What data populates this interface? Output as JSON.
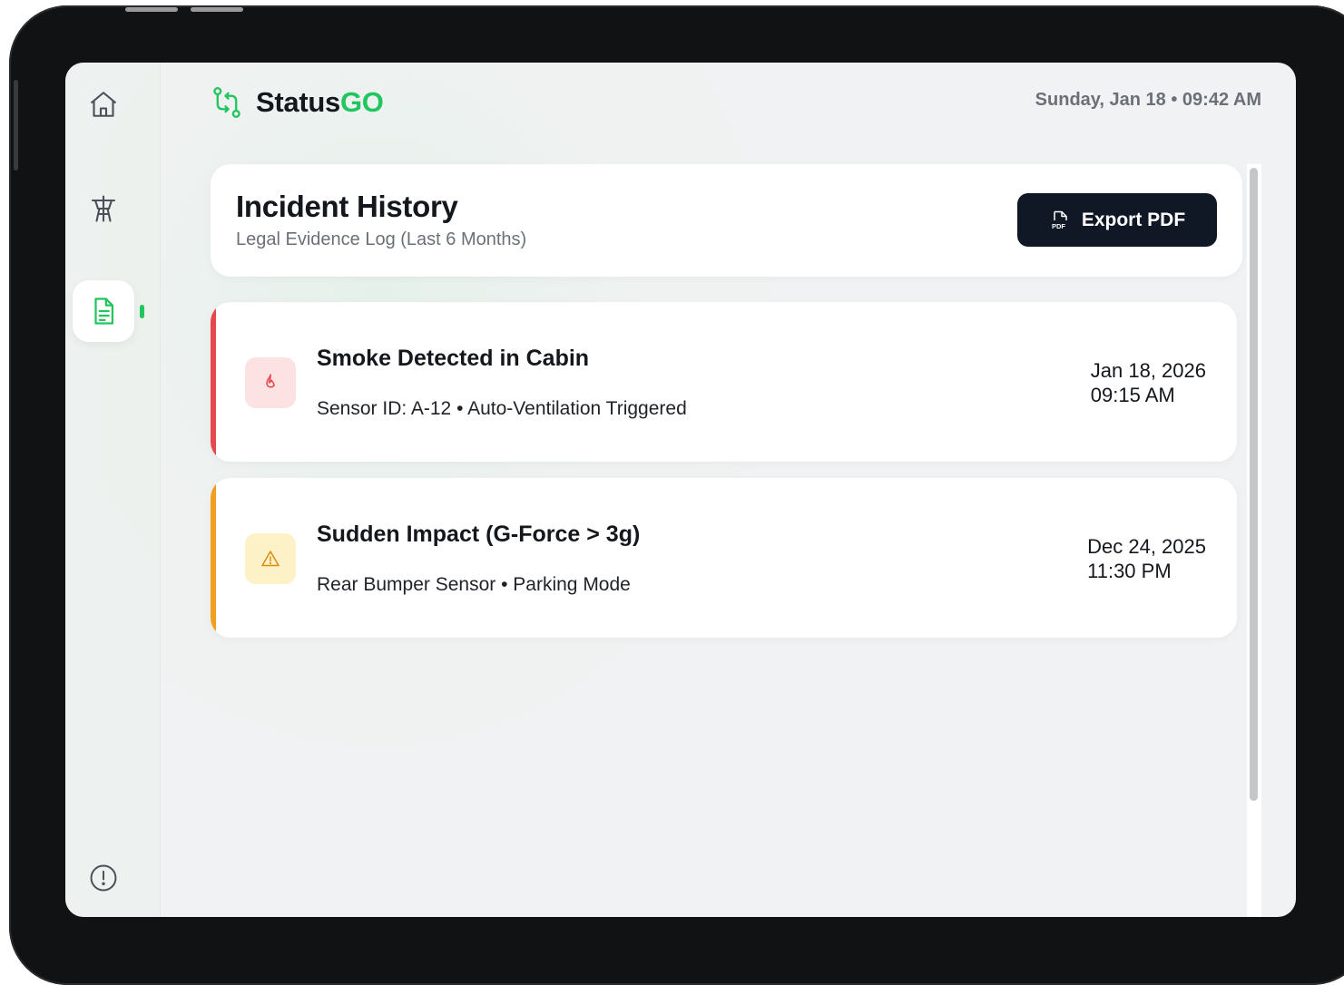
{
  "app": {
    "brand_prefix": "Status",
    "brand_suffix": "GO",
    "datetime": "Sunday, Jan 18 • 09:42 AM"
  },
  "sidebar": {
    "items": [
      {
        "icon": "home-icon",
        "active": false
      },
      {
        "icon": "antenna-tower-icon",
        "active": false
      },
      {
        "icon": "document-icon",
        "active": true
      },
      {
        "icon": "alert-circle-icon",
        "active": false
      }
    ]
  },
  "header": {
    "title": "Incident History",
    "subtitle": "Legal Evidence Log (Last 6 Months)",
    "export_label": "Export PDF",
    "export_icon": "pdf-file-icon"
  },
  "incidents": [
    {
      "title": "Smoke Detected in Cabin",
      "desc": "Sensor ID: A-12 • Auto-Ventilation Triggered",
      "date": "Jan 18, 2026",
      "time": "09:15 AM",
      "icon": "flame-icon",
      "accent": "#e5484d",
      "icon_bg": "#fde2e3"
    },
    {
      "title": "Sudden Impact (G-Force > 3g)",
      "desc": "Rear Bumper Sensor • Parking Mode",
      "date": "Dec 24, 2025",
      "time": "11:30 PM",
      "icon": "warning-triangle-icon",
      "accent": "#f0a020",
      "icon_bg": "#fdf1c8"
    }
  ],
  "colors": {
    "brand_green": "#22c55e",
    "button_dark": "#101826"
  }
}
